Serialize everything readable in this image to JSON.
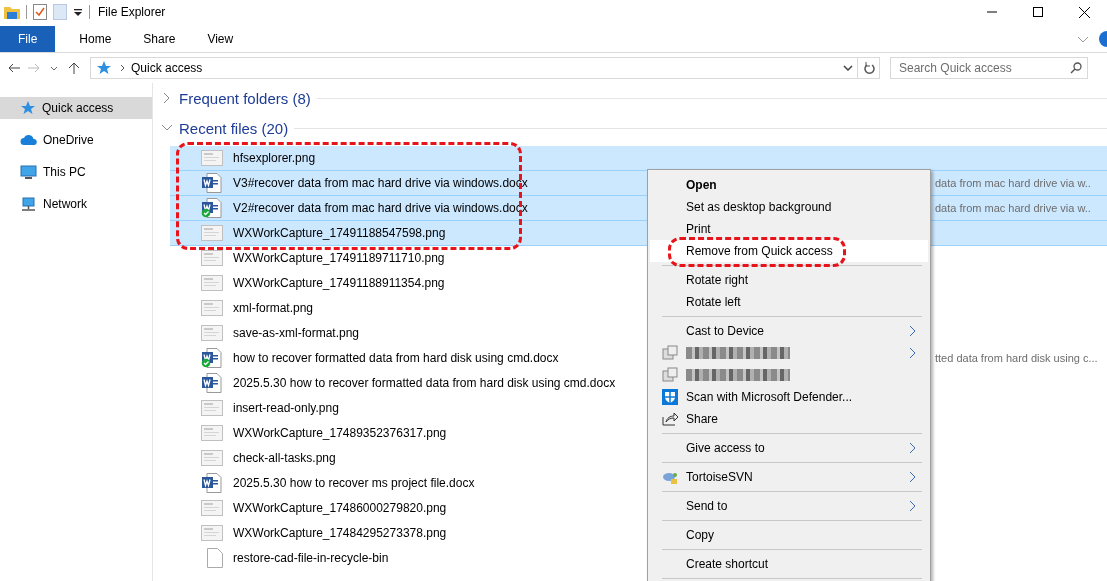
{
  "window": {
    "title": "File Explorer"
  },
  "ribbon_tabs": [
    {
      "label": "File",
      "selected": true
    },
    {
      "label": "Home",
      "selected": false
    },
    {
      "label": "Share",
      "selected": false
    },
    {
      "label": "View",
      "selected": false
    }
  ],
  "address": {
    "path": "Quick access"
  },
  "search": {
    "placeholder": "Search Quick access"
  },
  "sidebar": {
    "items": [
      {
        "label": "Quick access",
        "kind": "star",
        "selected": true
      },
      {
        "label": "OneDrive",
        "kind": "cloud",
        "selected": false
      },
      {
        "label": "This PC",
        "kind": "pc",
        "selected": false
      },
      {
        "label": "Network",
        "kind": "network",
        "selected": false
      }
    ]
  },
  "sections": [
    {
      "title": "Frequent folders (8)",
      "expanded": false
    },
    {
      "title": "Recent files (20)",
      "expanded": true
    }
  ],
  "recent_files": [
    {
      "name": "hfsexplorer.png",
      "kind": "image",
      "selected": true,
      "circled": true
    },
    {
      "name": "V3#recover data from mac hard drive via windows.docx",
      "kind": "word",
      "selected": true,
      "circled": true,
      "location": "data from mac hard drive via w.."
    },
    {
      "name": "V2#recover data from mac hard drive via windows.docx",
      "kind": "word-synced",
      "selected": true,
      "circled": true,
      "location": "data from mac hard drive via w.."
    },
    {
      "name": "WXWorkCapture_17491188547598.png",
      "kind": "image",
      "selected": true,
      "circled": true
    },
    {
      "name": "WXWorkCapture_17491189711710.png",
      "kind": "image",
      "selected": false,
      "circled": false
    },
    {
      "name": "WXWorkCapture_17491188911354.png",
      "kind": "image",
      "selected": false,
      "circled": false
    },
    {
      "name": "xml-format.png",
      "kind": "image",
      "selected": false,
      "circled": false
    },
    {
      "name": "save-as-xml-format.png",
      "kind": "image",
      "selected": false,
      "circled": false
    },
    {
      "name": "how to recover formatted data from hard disk using cmd.docx",
      "kind": "word-synced",
      "selected": false,
      "circled": false,
      "location": "tted data from hard disk using c..."
    },
    {
      "name": "2025.5.30 how to recover formatted data from hard disk using cmd.docx",
      "kind": "word",
      "selected": false,
      "circled": false
    },
    {
      "name": "insert-read-only.png",
      "kind": "image",
      "selected": false,
      "circled": false
    },
    {
      "name": "WXWorkCapture_17489352376317.png",
      "kind": "image",
      "selected": false,
      "circled": false
    },
    {
      "name": "check-all-tasks.png",
      "kind": "image",
      "selected": false,
      "circled": false
    },
    {
      "name": "2025.5.30 how to recover ms project file.docx",
      "kind": "word",
      "selected": false,
      "circled": false
    },
    {
      "name": "WXWorkCapture_17486000279820.png",
      "kind": "image",
      "selected": false,
      "circled": false
    },
    {
      "name": "WXWorkCapture_17484295273378.png",
      "kind": "image",
      "selected": false,
      "circled": false
    },
    {
      "name": "restore-cad-file-in-recycle-bin",
      "kind": "blank",
      "selected": false,
      "circled": false
    }
  ],
  "context_menu": [
    {
      "kind": "item",
      "label": "Open",
      "bold": true,
      "highlighted": false,
      "circled": false,
      "submenu": false
    },
    {
      "kind": "item",
      "label": "Set as desktop background",
      "bold": false,
      "highlighted": false,
      "circled": false,
      "submenu": false
    },
    {
      "kind": "item",
      "label": "Print",
      "bold": false,
      "highlighted": false,
      "circled": false,
      "submenu": false
    },
    {
      "kind": "item",
      "label": "Remove from Quick access",
      "bold": false,
      "highlighted": true,
      "circled": true,
      "submenu": false
    },
    {
      "kind": "separator"
    },
    {
      "kind": "item",
      "label": "Rotate right",
      "bold": false,
      "highlighted": false,
      "circled": false,
      "submenu": false
    },
    {
      "kind": "item",
      "label": "Rotate left",
      "bold": false,
      "highlighted": false,
      "circled": false,
      "submenu": false
    },
    {
      "kind": "separator"
    },
    {
      "kind": "item",
      "label": "Cast to Device",
      "bold": false,
      "highlighted": false,
      "circled": false,
      "submenu": true
    },
    {
      "kind": "blurred",
      "submenu": true
    },
    {
      "kind": "blurred",
      "submenu": false
    },
    {
      "kind": "shield-item",
      "label": "Scan with Microsoft Defender...",
      "bold": false,
      "highlighted": false,
      "circled": false,
      "submenu": false
    },
    {
      "kind": "share-item",
      "label": "Share",
      "bold": false,
      "highlighted": false,
      "circled": false,
      "submenu": false
    },
    {
      "kind": "separator"
    },
    {
      "kind": "item",
      "label": "Give access to",
      "bold": false,
      "highlighted": false,
      "circled": false,
      "submenu": true
    },
    {
      "kind": "separator"
    },
    {
      "kind": "svn-item",
      "label": "TortoiseSVN",
      "bold": false,
      "highlighted": false,
      "circled": false,
      "submenu": true
    },
    {
      "kind": "separator"
    },
    {
      "kind": "item",
      "label": "Send to",
      "bold": false,
      "highlighted": false,
      "circled": false,
      "submenu": true
    },
    {
      "kind": "separator"
    },
    {
      "kind": "item",
      "label": "Copy",
      "bold": false,
      "highlighted": false,
      "circled": false,
      "submenu": false
    },
    {
      "kind": "separator"
    },
    {
      "kind": "item",
      "label": "Create shortcut",
      "bold": false,
      "highlighted": false,
      "circled": false,
      "submenu": false
    },
    {
      "kind": "separator"
    }
  ]
}
